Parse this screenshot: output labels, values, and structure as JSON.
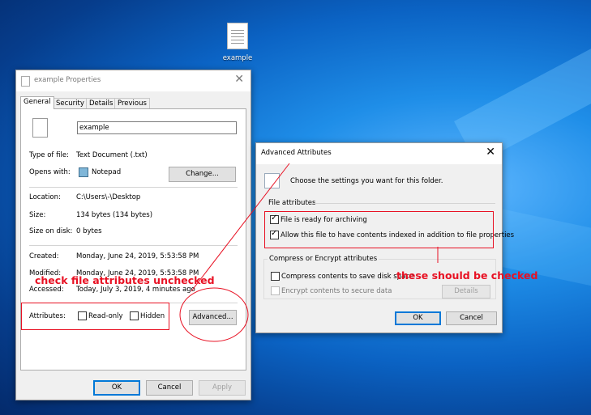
{
  "desktop": {
    "icon_label": "example"
  },
  "props": {
    "title": "example Properties",
    "tabs": [
      "General",
      "Security",
      "Details",
      "Previous Versions"
    ],
    "filename": "example",
    "type_label": "Type of file:",
    "type_value": "Text Document (.txt)",
    "opens_label": "Opens with:",
    "opens_value": "Notepad",
    "change_button": "Change...",
    "location_label": "Location:",
    "location_value": "C:\\Users\\-\\Desktop",
    "size_label": "Size:",
    "size_value": "134 bytes (134 bytes)",
    "sizedisk_label": "Size on disk:",
    "sizedisk_value": "0 bytes",
    "created_label": "Created:",
    "created_value": "Monday, June 24, 2019, 5:53:58 PM",
    "modified_label": "Modified:",
    "modified_value": "Monday, June 24, 2019, 5:53:58 PM",
    "accessed_label": "Accessed:",
    "accessed_value": "Today, July 3, 2019, 4 minutes ago",
    "attributes_label": "Attributes:",
    "readonly_label": "Read-only",
    "hidden_label": "Hidden",
    "advanced_button": "Advanced...",
    "ok": "OK",
    "cancel": "Cancel",
    "apply": "Apply"
  },
  "adv": {
    "title": "Advanced Attributes",
    "description": "Choose the settings you want for this folder.",
    "file_attributes_label": "File attributes",
    "archive_label": "File is ready for archiving",
    "index_label": "Allow this file to have contents indexed in addition to file properties",
    "compress_group_label": "Compress or Encrypt attributes",
    "compress_label": "Compress contents to save disk space",
    "encrypt_label": "Encrypt contents to secure data",
    "details_button": "Details",
    "ok": "OK",
    "cancel": "Cancel"
  },
  "annotations": {
    "left_note": "check file attributes unchecked",
    "right_note": "these should be checked",
    "color": "#e81123"
  }
}
